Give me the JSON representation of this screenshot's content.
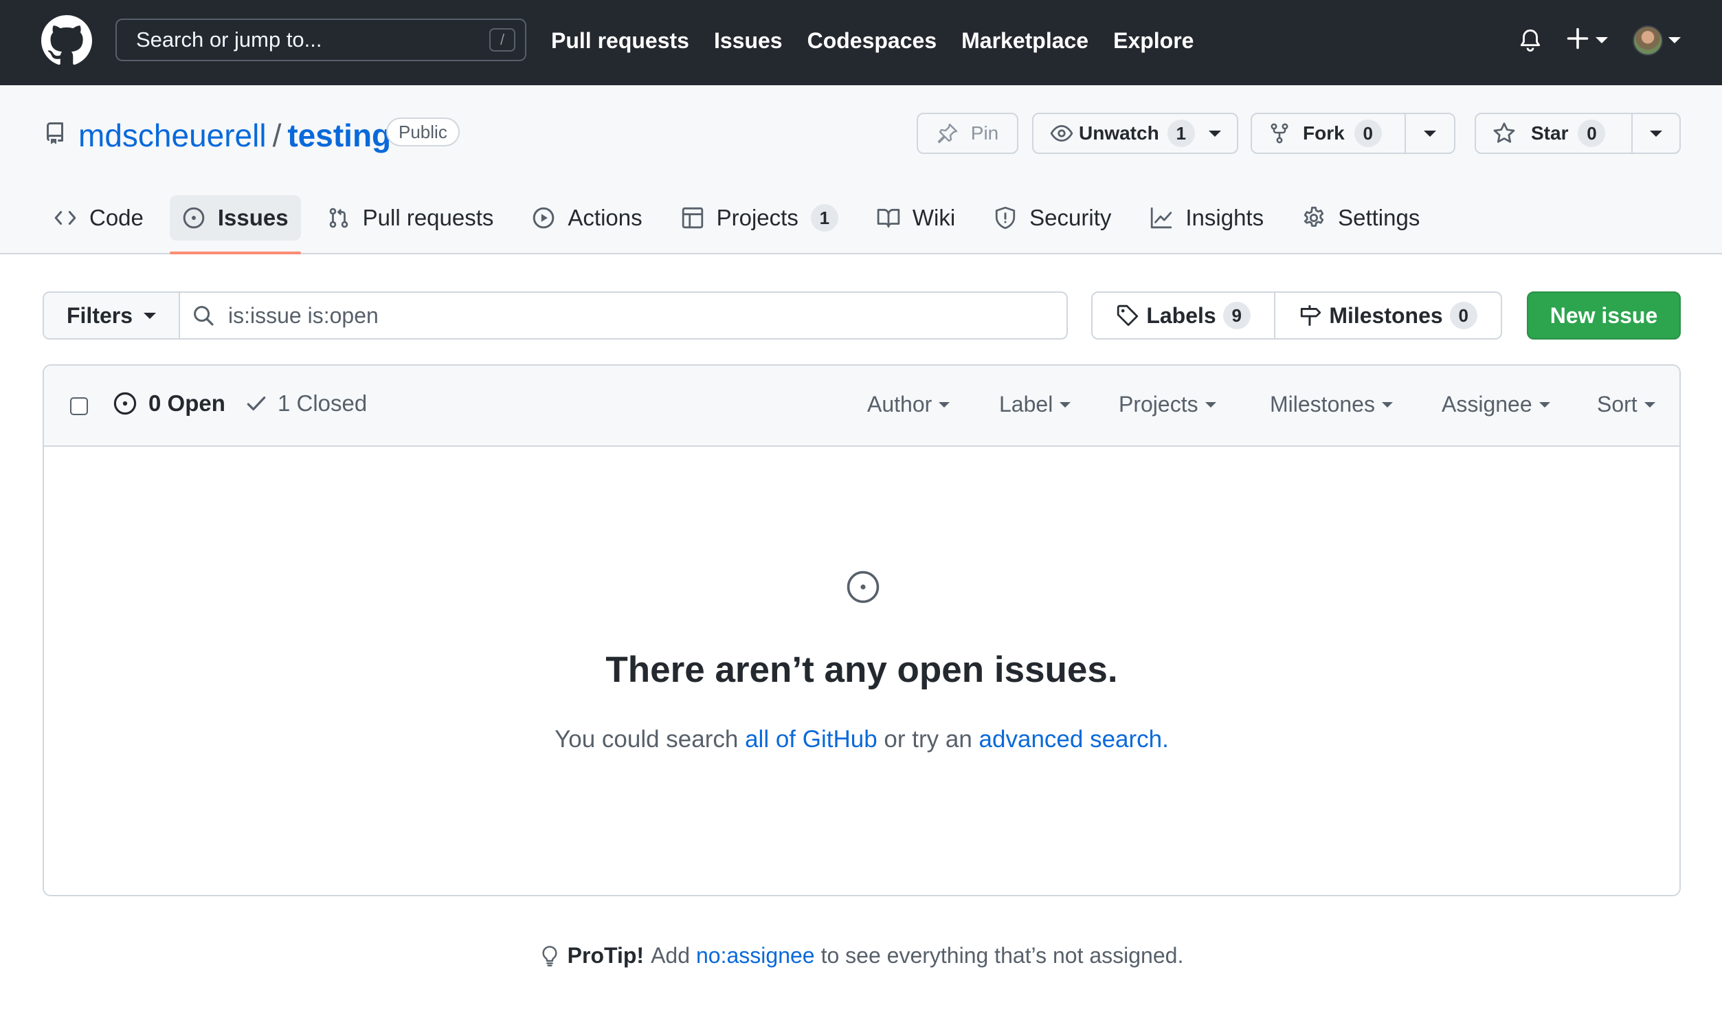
{
  "header": {
    "search_placeholder": "Search or jump to...",
    "search_shortcut": "/",
    "nav": [
      "Pull requests",
      "Issues",
      "Codespaces",
      "Marketplace",
      "Explore"
    ]
  },
  "repo": {
    "owner": "mdscheuerell",
    "separator": "/",
    "name": "testing",
    "visibility": "Public",
    "pin_label": "Pin",
    "unwatch_label": "Unwatch",
    "watch_count": "1",
    "fork_label": "Fork",
    "fork_count": "0",
    "star_label": "Star",
    "star_count": "0"
  },
  "tabs": [
    {
      "label": "Code",
      "icon": "code-icon"
    },
    {
      "label": "Issues",
      "icon": "issue-opened-icon",
      "active": true
    },
    {
      "label": "Pull requests",
      "icon": "git-pull-request-icon"
    },
    {
      "label": "Actions",
      "icon": "play-icon"
    },
    {
      "label": "Projects",
      "icon": "table-icon",
      "count": "1"
    },
    {
      "label": "Wiki",
      "icon": "book-icon"
    },
    {
      "label": "Security",
      "icon": "shield-icon"
    },
    {
      "label": "Insights",
      "icon": "graph-icon"
    },
    {
      "label": "Settings",
      "icon": "gear-icon"
    }
  ],
  "filterbar": {
    "filters_label": "Filters",
    "query": "is:issue is:open",
    "labels_label": "Labels",
    "labels_count": "9",
    "milestones_label": "Milestones",
    "milestones_count": "0",
    "new_issue_label": "New issue"
  },
  "issues": {
    "open_label": "0 Open",
    "closed_label": "1 Closed",
    "filters": [
      "Author",
      "Label",
      "Projects",
      "Milestones",
      "Assignee",
      "Sort"
    ],
    "blank_title": "There aren’t any open issues.",
    "blank_pre": "You could search",
    "blank_link1": "all of GitHub",
    "blank_mid": "or try an",
    "blank_link2": "advanced search",
    "blank_end": "."
  },
  "protip": {
    "title": "ProTip!",
    "pre": "Add",
    "link": "no:assignee",
    "post": "to see everything that’s not assigned."
  },
  "colors": {
    "header_bg": "#24292f",
    "link": "#0969da",
    "primary_button": "#2da44e",
    "active_tab_underline": "#fd8c73"
  }
}
